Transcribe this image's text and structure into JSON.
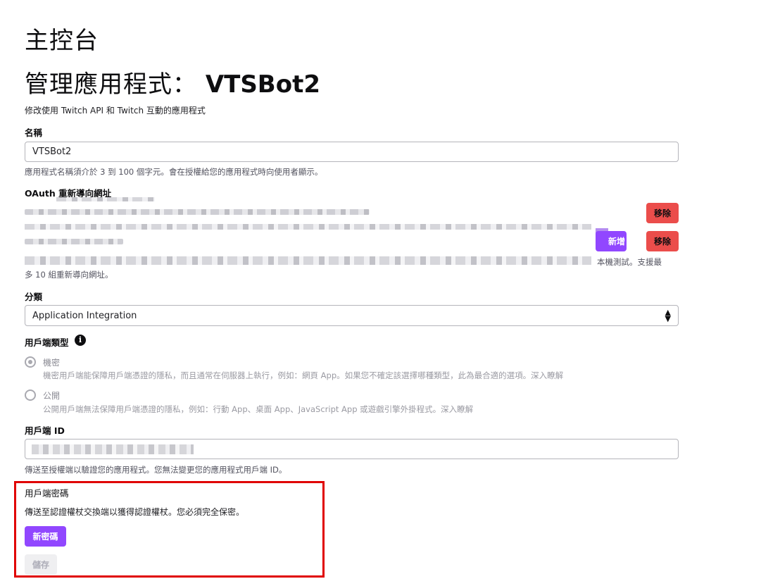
{
  "page": {
    "heading": "主控台",
    "app_heading_prefix": "管理應用程式：",
    "app_name": "VTSBot2",
    "subtitle": "修改使用 Twitch API 和 Twitch 互動的應用程式"
  },
  "name_field": {
    "label": "名稱",
    "value": "VTSBot2",
    "help": "應用程式名稱須介於 3 到 100 個字元。會在授權給您的應用程式時向使用者顯示。"
  },
  "oauth": {
    "label": "OAuth 重新導向網址",
    "remove_label": "移除",
    "add_label": "新增",
    "help_tail_line1": "本機測試。支援最",
    "help_line2": "多 10 組重新導向網址。"
  },
  "category": {
    "label": "分類",
    "selected": "Application Integration"
  },
  "client_type": {
    "label": "用戶端類型",
    "info_icon": "info-icon",
    "options": [
      {
        "title": "機密",
        "description": "機密用戶端能保障用戶端憑證的隱私，而且通常在伺服器上執行，例如：網頁 App。如果您不確定該選擇哪種類型，此為最合適的選項。深入瞭解",
        "checked": true
      },
      {
        "title": "公開",
        "description": "公開用戶端無法保障用戶端憑證的隱私，例如：行動 App、桌面 App、JavaScript App 或遊戲引擎外掛程式。深入瞭解",
        "checked": false
      }
    ]
  },
  "client_id": {
    "label": "用戶端 ID",
    "help": "傳送至授權端以驗證您的應用程式。您無法變更您的應用程式用戶端 ID。"
  },
  "client_secret": {
    "label": "用戶端密碼",
    "description": "傳送至認證權杖交換端以獲得認證權杖。您必須完全保密。",
    "new_secret_label": "新密碼"
  },
  "save_label": "儲存",
  "colors": {
    "accent_purple": "#9147ff",
    "remove_red": "#eb4d4b",
    "highlight_red": "#e00000"
  }
}
